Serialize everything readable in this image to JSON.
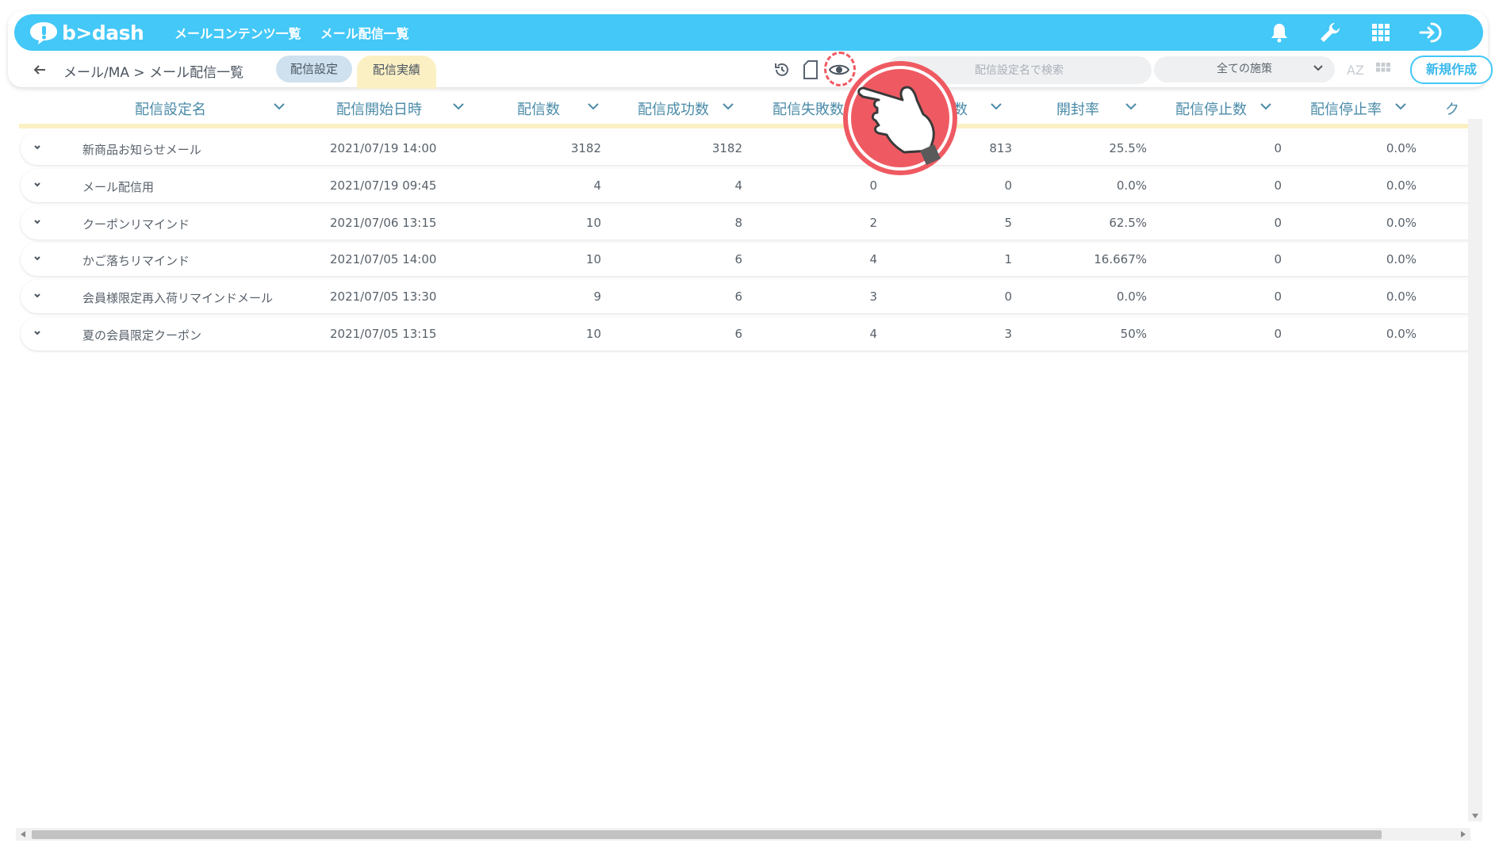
{
  "app": {
    "logo_text": "b>dash",
    "nav": [
      "メールコンテンツ一覧",
      "メール配信一覧"
    ]
  },
  "subbar": {
    "breadcrumb": "メール/MA > メール配信一覧",
    "tabs": {
      "settings": "配信設定",
      "results": "配信実績"
    },
    "search_placeholder": "配信設定名で検索",
    "filter_selected": "全ての施策",
    "sort_label": "AZ",
    "new_button": "新規作成"
  },
  "table": {
    "columns": [
      "配信設定名",
      "配信開始日時",
      "配信数",
      "配信成功数",
      "配信失敗数",
      "数",
      "開封率",
      "配信停止数",
      "配信停止率",
      "ク"
    ],
    "rows": [
      [
        "新商品お知らせメール",
        "2021/07/19 14:00",
        "3182",
        "3182",
        "",
        "813",
        "25.5%",
        "0",
        "0.0%"
      ],
      [
        "メール配信用",
        "2021/07/19 09:45",
        "4",
        "4",
        "0",
        "0",
        "0.0%",
        "0",
        "0.0%"
      ],
      [
        "クーポンリマインド",
        "2021/07/06 13:15",
        "10",
        "8",
        "2",
        "5",
        "62.5%",
        "0",
        "0.0%"
      ],
      [
        "かご落ちリマインド",
        "2021/07/05 14:00",
        "10",
        "6",
        "4",
        "1",
        "16.667%",
        "0",
        "0.0%"
      ],
      [
        "会員様限定再入荷リマインドメール",
        "2021/07/05 13:30",
        "9",
        "6",
        "3",
        "0",
        "0.0%",
        "0",
        "0.0%"
      ],
      [
        "夏の会員限定クーポン",
        "2021/07/05 13:15",
        "10",
        "6",
        "4",
        "3",
        "50%",
        "0",
        "0.0%"
      ]
    ]
  },
  "colors": {
    "brand": "#43c8f7",
    "header_text": "#4a8ba8",
    "accent_tab": "#fbf0c4",
    "pointer": "#ef5a62"
  }
}
